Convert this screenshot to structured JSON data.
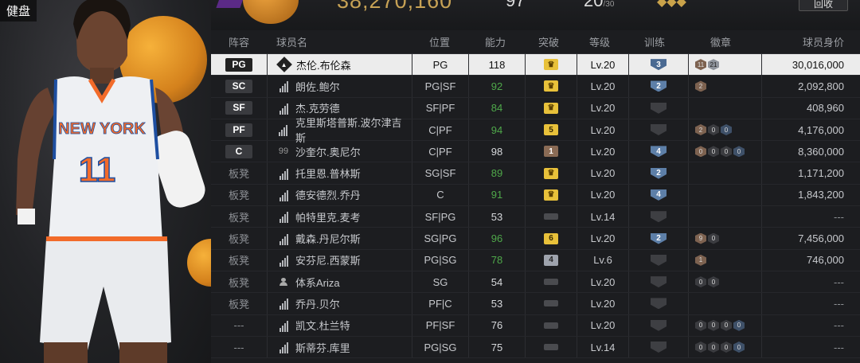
{
  "header": {
    "top_left_label": "健盘",
    "team_value": "38,270,160",
    "stat_a": "97",
    "stat_b": "20",
    "stat_b_sub": "/30",
    "recycle_button": "回收"
  },
  "columns": [
    "阵容",
    "球员名",
    "位置",
    "能力",
    "突破",
    "等级",
    "训练",
    "徽章",
    "球员身价"
  ],
  "colors": {
    "selected_row_bg": "#ececec",
    "green_rating": "#4fa84a",
    "gold": "#e8c13a",
    "training_blue": "#5d7fa8"
  },
  "rows": [
    {
      "slot": "PG",
      "slot_type": "starter",
      "icon": "diamond-rank-icon",
      "name": "杰伦.布伦森",
      "pos": "PG",
      "ovr": "118",
      "ovr_color": "white",
      "breakthrough": "crown",
      "level": "Lv.20",
      "training": "3",
      "badges": [
        {
          "t": "bz",
          "v": "11"
        },
        {
          "t": "sv",
          "v": "21"
        }
      ],
      "value": "30,016,000",
      "selected": true
    },
    {
      "slot": "SC",
      "slot_type": "starter",
      "icon": "signal-bars-icon",
      "name": "朗佐.鲍尔",
      "pos": "PG|SF",
      "ovr": "92",
      "ovr_color": "green",
      "breakthrough": "crown",
      "level": "Lv.20",
      "training": "2",
      "badges": [
        {
          "t": "bz",
          "v": "2"
        }
      ],
      "value": "2,092,800"
    },
    {
      "slot": "SF",
      "slot_type": "starter",
      "icon": "signal-bars-icon",
      "name": "杰.克劳德",
      "pos": "SF|PF",
      "ovr": "84",
      "ovr_color": "green",
      "breakthrough": "crown",
      "level": "Lv.20",
      "training": "",
      "badges": [],
      "value": "408,960"
    },
    {
      "slot": "PF",
      "slot_type": "starter",
      "icon": "signal-bars-icon",
      "name": "克里斯塔普斯.波尔津吉斯",
      "pos": "C|PF",
      "ovr": "94",
      "ovr_color": "green",
      "breakthrough": "5",
      "level": "Lv.20",
      "training": "",
      "badges": [
        {
          "t": "bz",
          "v": "2"
        },
        {
          "t": "dk",
          "v": "0"
        },
        {
          "t": "bl",
          "v": "0"
        }
      ],
      "value": "4,176,000"
    },
    {
      "slot": "C",
      "slot_type": "starter",
      "icon": "99-icon",
      "name": "沙奎尔.奥尼尔",
      "pos": "C|PF",
      "ovr": "98",
      "ovr_color": "white",
      "breakthrough": "1",
      "level": "Lv.20",
      "training": "4",
      "badges": [
        {
          "t": "bz",
          "v": "0"
        },
        {
          "t": "dk",
          "v": "0"
        },
        {
          "t": "dk",
          "v": "0"
        },
        {
          "t": "bl",
          "v": "0"
        }
      ],
      "value": "8,360,000"
    },
    {
      "slot": "板凳",
      "slot_type": "bench",
      "icon": "signal-bars-icon",
      "name": "托里恩.普林斯",
      "pos": "SG|SF",
      "ovr": "89",
      "ovr_color": "green",
      "breakthrough": "crown",
      "level": "Lv.20",
      "training": "2",
      "badges": [],
      "value": "1,171,200"
    },
    {
      "slot": "板凳",
      "slot_type": "bench",
      "icon": "signal-bars-icon",
      "name": "德安德烈.乔丹",
      "pos": "C",
      "ovr": "91",
      "ovr_color": "green",
      "breakthrough": "crown",
      "level": "Lv.20",
      "training": "4",
      "badges": [],
      "value": "1,843,200"
    },
    {
      "slot": "板凳",
      "slot_type": "bench",
      "icon": "signal-bars-icon",
      "name": "帕特里克.麦考",
      "pos": "SF|PG",
      "ovr": "53",
      "ovr_color": "white",
      "breakthrough": "",
      "level": "Lv.14",
      "training": "",
      "badges": [],
      "value": "---"
    },
    {
      "slot": "板凳",
      "slot_type": "bench",
      "icon": "signal-bars-icon",
      "name": "戴森.丹尼尔斯",
      "pos": "SG|PG",
      "ovr": "96",
      "ovr_color": "green",
      "breakthrough": "6",
      "level": "Lv.20",
      "training": "2",
      "badges": [
        {
          "t": "bz",
          "v": "9"
        },
        {
          "t": "dk",
          "v": "0"
        }
      ],
      "value": "7,456,000"
    },
    {
      "slot": "板凳",
      "slot_type": "bench",
      "icon": "signal-bars-icon",
      "name": "安芬尼.西蒙斯",
      "pos": "PG|SG",
      "ovr": "78",
      "ovr_color": "green",
      "breakthrough": "4",
      "level": "Lv.6",
      "training": "",
      "badges": [
        {
          "t": "bz",
          "v": "1"
        }
      ],
      "value": "746,000"
    },
    {
      "slot": "板凳",
      "slot_type": "bench",
      "icon": "person-icon",
      "name": "体系Ariza",
      "pos": "SG",
      "ovr": "54",
      "ovr_color": "white",
      "breakthrough": "",
      "level": "Lv.20",
      "training": "",
      "badges": [
        {
          "t": "dk",
          "v": "0"
        },
        {
          "t": "dk",
          "v": "0"
        }
      ],
      "value": "---"
    },
    {
      "slot": "板凳",
      "slot_type": "bench",
      "icon": "signal-bars-icon",
      "name": "乔丹.贝尔",
      "pos": "PF|C",
      "ovr": "53",
      "ovr_color": "white",
      "breakthrough": "",
      "level": "Lv.20",
      "training": "",
      "badges": [],
      "value": "---"
    },
    {
      "slot": "---",
      "slot_type": "reserve",
      "icon": "signal-bars-icon",
      "name": "凯文.杜兰特",
      "pos": "PF|SF",
      "ovr": "76",
      "ovr_color": "white",
      "breakthrough": "",
      "level": "Lv.20",
      "training": "",
      "badges": [
        {
          "t": "dk",
          "v": "0"
        },
        {
          "t": "dk",
          "v": "0"
        },
        {
          "t": "dk",
          "v": "0"
        },
        {
          "t": "bl",
          "v": "0"
        }
      ],
      "value": "---"
    },
    {
      "slot": "---",
      "slot_type": "reserve",
      "icon": "signal-bars-icon",
      "name": "斯蒂芬.库里",
      "pos": "PG|SG",
      "ovr": "75",
      "ovr_color": "white",
      "breakthrough": "",
      "level": "Lv.14",
      "training": "",
      "badges": [
        {
          "t": "dk",
          "v": "0"
        },
        {
          "t": "dk",
          "v": "0"
        },
        {
          "t": "dk",
          "v": "0"
        },
        {
          "t": "bl",
          "v": "0"
        }
      ],
      "value": "---"
    }
  ],
  "player_art": {
    "jersey_team": "NEW YORK",
    "jersey_number": "11"
  }
}
